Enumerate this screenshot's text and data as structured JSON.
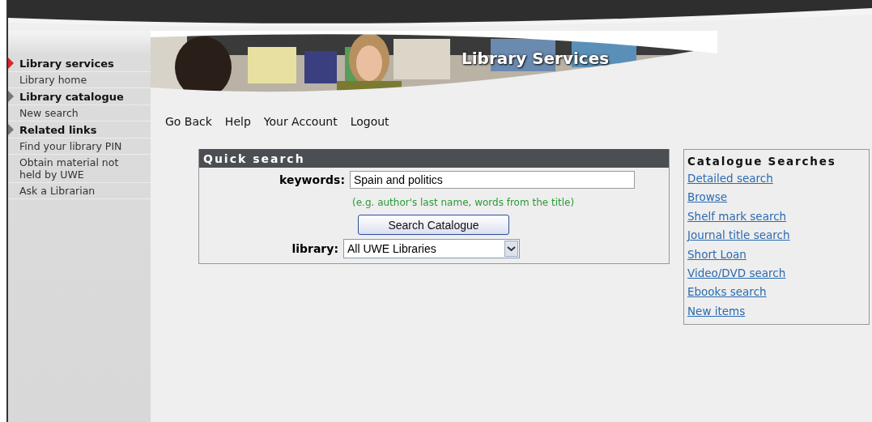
{
  "banner": {
    "title": "Library Services",
    "kind": "picture"
  },
  "sidebar": {
    "sections": [
      {
        "heading": "Library services",
        "selected": true,
        "items": [
          "Library home"
        ]
      },
      {
        "heading": "Library catalogue",
        "selected": false,
        "items": [
          "New search"
        ]
      },
      {
        "heading": "Related links",
        "selected": false,
        "items": [
          "Find your library PIN",
          "Obtain material not held by UWE",
          "Ask a Librarian"
        ]
      }
    ]
  },
  "nav": [
    "Go Back",
    "Help",
    "Your Account",
    "Logout"
  ],
  "quick_search": {
    "title": "Quick search",
    "keywords_label": "keywords:",
    "keywords_value": "Spain and politics",
    "hint": "(e.g. author's last name, words from the title)",
    "button": "Search Catalogue",
    "library_label": "library:",
    "library_value": "All UWE Libraries"
  },
  "catalogue_searches": {
    "title": "Catalogue Searches",
    "links": [
      "Detailed search",
      "Browse",
      "Shelf mark search",
      "Journal title search",
      "Short Loan",
      "Video/DVD search",
      "Ebooks search",
      "New items"
    ]
  }
}
